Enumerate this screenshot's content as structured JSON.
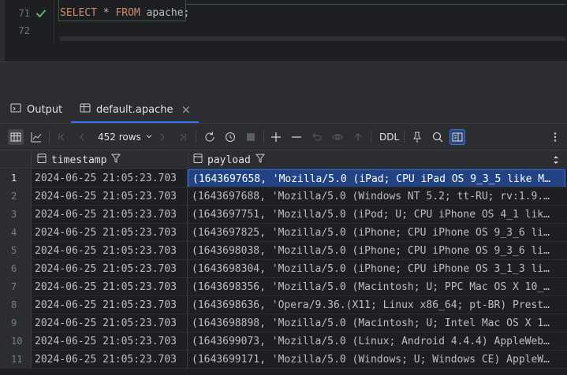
{
  "editor": {
    "lines": [
      {
        "number": "71",
        "keyword1": "SELECT",
        "middle": " * ",
        "keyword2": "FROM",
        "rest": " apache;"
      },
      {
        "number": "72"
      }
    ]
  },
  "tabs": [
    {
      "label": "Output",
      "icon": "output-icon"
    },
    {
      "label": "default.apache",
      "icon": "table-icon",
      "close": "×"
    }
  ],
  "toolbar": {
    "rows_label": "452 rows",
    "ddl_label": "DDL"
  },
  "grid": {
    "columns": [
      {
        "name": "timestamp"
      },
      {
        "name": "payload"
      }
    ],
    "rows": [
      {
        "n": "1",
        "ts": "2024-06-25 21:05:23.703",
        "payload": "(1643697658, 'Mozilla/5.0 (iPad; CPU iPad OS 9_3_5 like M…"
      },
      {
        "n": "2",
        "ts": "2024-06-25 21:05:23.703",
        "payload": "(1643697688, 'Mozilla/5.0 (Windows NT 5.2; tt-RU; rv:1.9.…"
      },
      {
        "n": "3",
        "ts": "2024-06-25 21:05:23.703",
        "payload": "(1643697751, 'Mozilla/5.0 (iPod; U; CPU iPhone OS 4_1 lik…"
      },
      {
        "n": "4",
        "ts": "2024-06-25 21:05:23.703",
        "payload": "(1643697825, 'Mozilla/5.0 (iPhone; CPU iPhone OS 9_3_6 li…"
      },
      {
        "n": "5",
        "ts": "2024-06-25 21:05:23.703",
        "payload": "(1643698038, 'Mozilla/5.0 (iPhone; CPU iPhone OS 9_3_6 li…"
      },
      {
        "n": "6",
        "ts": "2024-06-25 21:05:23.703",
        "payload": "(1643698304, 'Mozilla/5.0 (iPhone; CPU iPhone OS 3_1_3 li…"
      },
      {
        "n": "7",
        "ts": "2024-06-25 21:05:23.703",
        "payload": "(1643698356, 'Mozilla/5.0 (Macintosh; U; PPC Mac OS X 10_…"
      },
      {
        "n": "8",
        "ts": "2024-06-25 21:05:23.703",
        "payload": "(1643698636, 'Opera/9.36.(X11; Linux x86_64; pt-BR) Prest…"
      },
      {
        "n": "9",
        "ts": "2024-06-25 21:05:23.703",
        "payload": "(1643698898, 'Mozilla/5.0 (Macintosh; U; Intel Mac OS X 1…"
      },
      {
        "n": "10",
        "ts": "2024-06-25 21:05:23.703",
        "payload": "(1643699073, 'Mozilla/5.0 (Linux; Android 4.4.4) AppleWeb…"
      },
      {
        "n": "11",
        "ts": "2024-06-25 21:05:23.703",
        "payload": "(1643699171, 'Mozilla/5.0 (Windows; U; Windows CE) AppleW…"
      }
    ]
  },
  "colors": {
    "accent": "#3574f0",
    "selection": "#214283",
    "keyword": "#cf8e6d",
    "success": "#5fb865"
  }
}
